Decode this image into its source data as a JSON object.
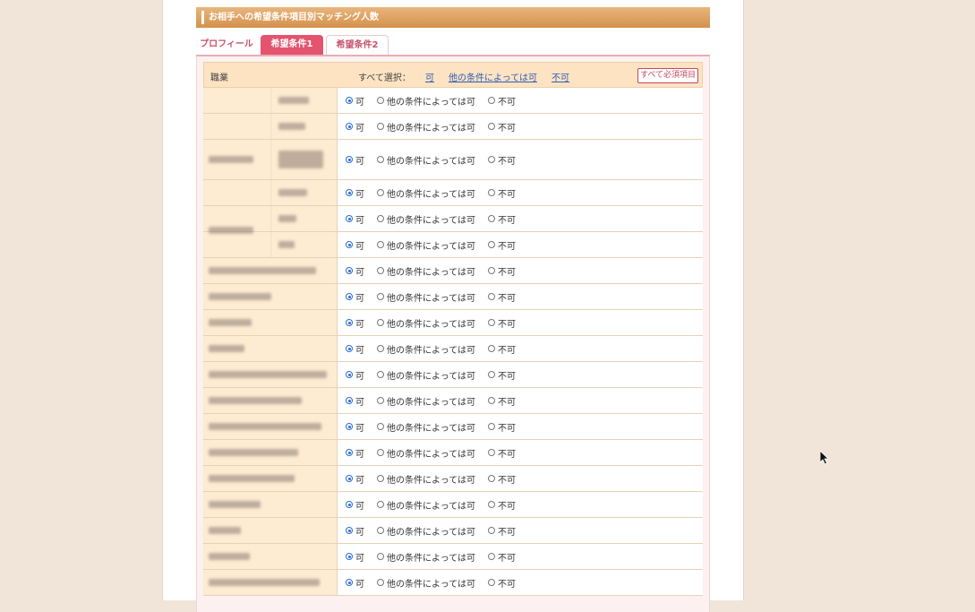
{
  "header": {
    "title": "お相手への希望条件項目別マッチング人数"
  },
  "tabs": [
    {
      "label": "プロフィール",
      "active": false
    },
    {
      "label": "希望条件1",
      "active": true
    },
    {
      "label": "希望条件2",
      "active": false
    }
  ],
  "table_header": {
    "label": "職業",
    "select_all_label": "すべて選択：",
    "links": [
      "可",
      "他の条件によっては可",
      "不可"
    ],
    "required_button": "すべて必須項目"
  },
  "options": [
    "可",
    "他の条件によっては可",
    "不可"
  ],
  "row_selected_option": "可",
  "row_count": 19,
  "colors": {
    "header_orange": "#d4924d",
    "active_tab": "#e4546e",
    "category_bg": "#fdebd2",
    "link_blue": "#2f5db8"
  }
}
